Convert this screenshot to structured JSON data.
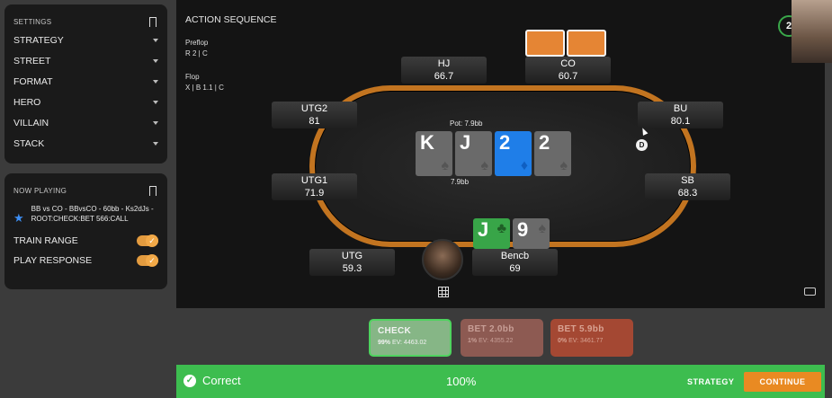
{
  "settings": {
    "title": "SETTINGS",
    "items": [
      {
        "label": "STRATEGY"
      },
      {
        "label": "STREET"
      },
      {
        "label": "FORMAT"
      },
      {
        "label": "HERO"
      },
      {
        "label": "VILLAIN"
      },
      {
        "label": "STACK"
      }
    ]
  },
  "now_playing": {
    "title": "NOW PLAYING",
    "description": "BB vs CO - BBvsCO - 60bb - Ks2dJs - ROOT:CHECK:BET 566:CALL",
    "toggles": [
      {
        "label": "TRAIN RANGE",
        "on": true
      },
      {
        "label": "PLAY RESPONSE",
        "on": true
      }
    ]
  },
  "action_sequence": {
    "title": "ACTION SEQUENCE",
    "preflop_label": "Preflop",
    "preflop_actions": "R 2  |  C",
    "flop_label": "Flop",
    "flop_actions": "X  |  B 1.1  |  C"
  },
  "table": {
    "pot": "Pot: 7.9bb",
    "pot_chips": "7.9bb",
    "dealer_button": "D",
    "timer": "2",
    "board": [
      {
        "rank": "K",
        "suit": "♠",
        "color": "grey"
      },
      {
        "rank": "J",
        "suit": "♠",
        "color": "grey"
      },
      {
        "rank": "2",
        "suit": "♦",
        "color": "blue"
      },
      {
        "rank": "2",
        "suit": "♠",
        "color": "grey"
      }
    ],
    "hero_cards": [
      {
        "rank": "J",
        "suit": "♣",
        "color": "green"
      },
      {
        "rank": "9",
        "suit": "♠",
        "color": "grey"
      }
    ],
    "seats": {
      "hj": {
        "name": "HJ",
        "stack": "66.7"
      },
      "co": {
        "name": "CO",
        "stack": "60.7"
      },
      "utg2": {
        "name": "UTG2",
        "stack": "81"
      },
      "bu": {
        "name": "BU",
        "stack": "80.1"
      },
      "utg1": {
        "name": "UTG1",
        "stack": "71.9"
      },
      "sb": {
        "name": "SB",
        "stack": "68.3"
      },
      "utg": {
        "name": "UTG",
        "stack": "59.3"
      },
      "hero": {
        "name": "Bencb",
        "stack": "69"
      }
    }
  },
  "actions": {
    "check": {
      "label": "CHECK",
      "freq": "99%",
      "ev": "EV: 4463.02"
    },
    "bet_small": {
      "label": "BET 2.0bb",
      "freq": "1%",
      "ev": "EV: 4355.22"
    },
    "bet_big": {
      "label": "BET 5.9bb",
      "freq": "0%",
      "ev": "EV: 3461.77"
    }
  },
  "result": {
    "status": "Correct",
    "score": "100%",
    "strategy_label": "STRATEGY",
    "continue_label": "CONTINUE"
  },
  "colors": {
    "accent_orange": "#e98a22",
    "correct_green": "#3dbd4f",
    "blue_card": "#1f7ee8",
    "green_card": "#38a548"
  }
}
